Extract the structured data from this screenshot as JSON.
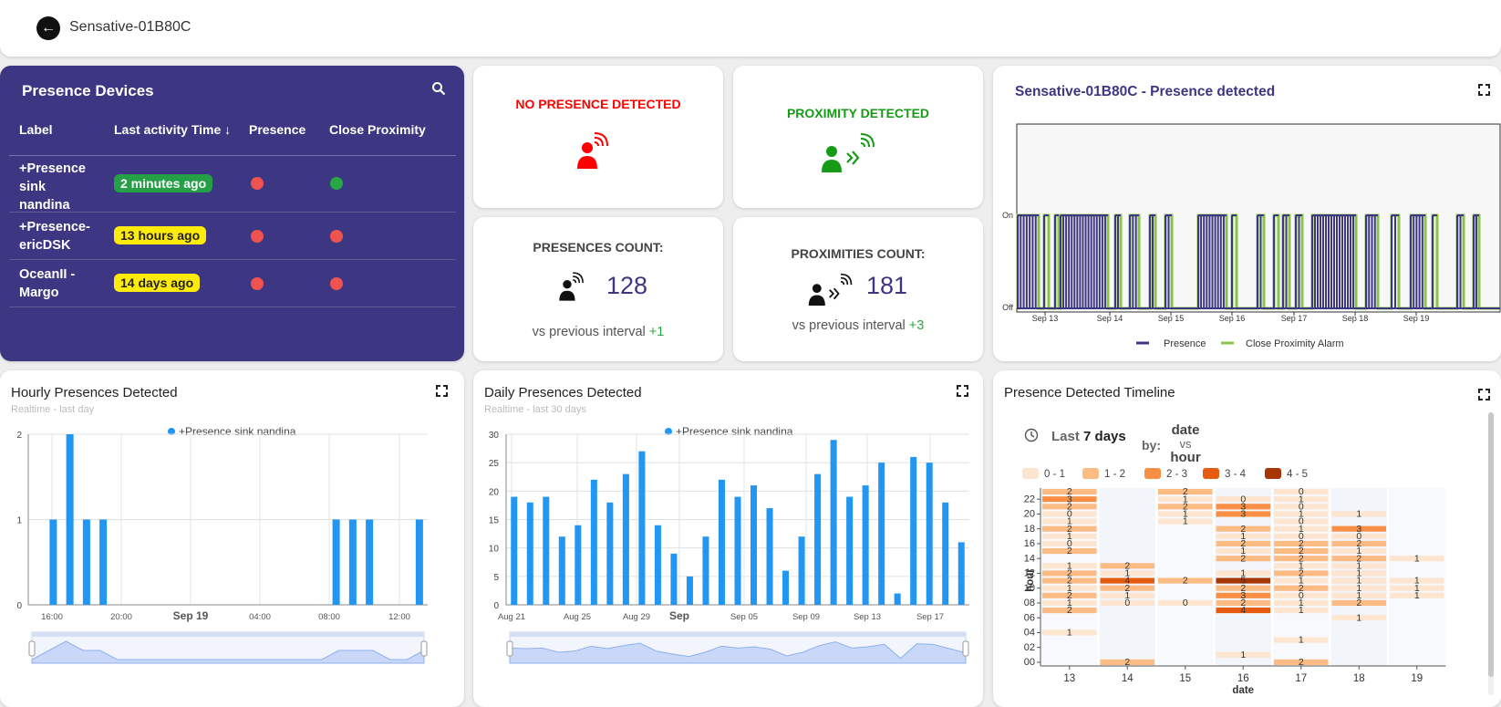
{
  "header": {
    "device_name": "Sensative-01B80C",
    "back_icon": "arrow-left-icon"
  },
  "devices": {
    "title": "Presence Devices",
    "columns": [
      "Label",
      "Last activity Time",
      "Presence",
      "Close Proximity"
    ],
    "sort_icon": "arrow-down-icon",
    "rows": [
      {
        "label": [
          "+Presence",
          "sink",
          "nandina"
        ],
        "time": "2 minutes ago",
        "time_color": "#26a047",
        "presence": "#ef5350",
        "proximity": "#27a844"
      },
      {
        "label": [
          "+Presence-",
          "ericDSK"
        ],
        "time": "13 hours ago",
        "time_color": "#ffeb0a",
        "presence": "#ef5350",
        "proximity": "#ef5350"
      },
      {
        "label": [
          "OceanII -",
          "Margo"
        ],
        "time": "14 days ago",
        "time_color": "#ffeb0a",
        "presence": "#ef5350",
        "proximity": "#ef5350"
      }
    ]
  },
  "status": {
    "presence": {
      "text": "NO PRESENCE DETECTED",
      "color": "#ff0000"
    },
    "proximity": {
      "text": "PROXIMITY DETECTED",
      "color": "#159b15"
    }
  },
  "counts": {
    "presences": {
      "title": "PRESENCES COUNT:",
      "value": "128",
      "vs": "vs previous interval",
      "delta": "+1"
    },
    "proximities": {
      "title": "PROXIMITIES COUNT:",
      "value": "181",
      "vs": "vs previous interval",
      "delta": "+3"
    }
  },
  "timeline_chart": {
    "title": "Sensative-01B80C - Presence detected",
    "y_labels": [
      "On",
      "Off"
    ],
    "x_labels": [
      "Sep 13",
      "Sep 14",
      "Sep 15",
      "Sep 16",
      "Sep 17",
      "Sep 18",
      "Sep 19"
    ],
    "legend": [
      "Presence",
      "Close Proximity Alarm"
    ],
    "colors": {
      "presence": "#3d3783",
      "proximity": "#8bc34a"
    }
  },
  "hourly": {
    "title": "Hourly Presences Detected",
    "subtitle": "Realtime - last day",
    "series_name": "+Presence sink nandina"
  },
  "daily": {
    "title": "Daily Presences Detected",
    "subtitle": "Realtime - last 30 days",
    "series_name": "+Presence sink nandina"
  },
  "heatmap": {
    "title": "Presence Detected Timeline",
    "range_prefix": "Last",
    "range_value": "7 days",
    "by": "by:",
    "date": "date",
    "vs": "vs",
    "hour": "hour",
    "legend": [
      "0 - 1",
      "1 - 2",
      "2 - 3",
      "3 - 4",
      "4 - 5"
    ],
    "legend_colors": [
      "#fde5d0",
      "#fdbb84",
      "#f88f45",
      "#e65b0f",
      "#a63603"
    ],
    "x_labels": [
      "13",
      "14",
      "15",
      "16",
      "17",
      "18",
      "19"
    ],
    "y_labels": [
      "22",
      "20",
      "18",
      "16",
      "14",
      "12",
      "10",
      "08",
      "06",
      "04",
      "02",
      "00"
    ],
    "xlabel": "date",
    "ylabel": "hour"
  },
  "chart_data": [
    {
      "type": "bar",
      "title": "Hourly Presences Detected",
      "x": [
        "15:00",
        "16:00",
        "17:00",
        "18:00",
        "19:00",
        "20:00",
        "21:00",
        "22:00",
        "23:00",
        "Sep 19",
        "01:00",
        "02:00",
        "03:00",
        "04:00",
        "05:00",
        "06:00",
        "07:00",
        "08:00",
        "09:00",
        "10:00",
        "11:00",
        "12:00",
        "13:00",
        "14:00"
      ],
      "tick_labels": [
        "16:00",
        "20:00",
        "Sep 19",
        "04:00",
        "08:00",
        "12:00"
      ],
      "series": [
        {
          "name": "+Presence sink nandina",
          "values": [
            0,
            1,
            2,
            1,
            1,
            0,
            0,
            0,
            0,
            0,
            0,
            0,
            0,
            0,
            0,
            0,
            0,
            0,
            1,
            1,
            1,
            0,
            0,
            1
          ]
        }
      ],
      "ylim": [
        0,
        2
      ],
      "yticks": [
        0,
        1,
        2
      ]
    },
    {
      "type": "bar",
      "title": "Daily Presences Detected",
      "tick_labels": [
        "Aug 21",
        "Aug 25",
        "Aug 29",
        "Sep",
        "Sep 05",
        "Sep 09",
        "Sep 13",
        "Sep 17"
      ],
      "series": [
        {
          "name": "+Presence sink nandina",
          "values": [
            19,
            18,
            19,
            12,
            14,
            22,
            18,
            23,
            27,
            14,
            9,
            5,
            12,
            22,
            19,
            21,
            17,
            6,
            12,
            23,
            29,
            19,
            21,
            25,
            2,
            26,
            25,
            18,
            11
          ]
        }
      ],
      "ylim": [
        0,
        30
      ],
      "yticks": [
        0,
        5,
        10,
        15,
        20,
        25,
        30
      ]
    },
    {
      "type": "heatmap",
      "title": "Presence Detected Timeline",
      "x": [
        "13",
        "14",
        "15",
        "16",
        "17",
        "18",
        "19"
      ],
      "cells": [
        {
          "d": 0,
          "h": 23,
          "v": 2
        },
        {
          "d": 0,
          "h": 22,
          "v": 3
        },
        {
          "d": 0,
          "h": 21,
          "v": 2
        },
        {
          "d": 0,
          "h": 20,
          "v": 0
        },
        {
          "d": 0,
          "h": 19,
          "v": 1
        },
        {
          "d": 0,
          "h": 18,
          "v": 2
        },
        {
          "d": 0,
          "h": 17,
          "v": 1
        },
        {
          "d": 0,
          "h": 16,
          "v": 0
        },
        {
          "d": 0,
          "h": 15,
          "v": 2
        },
        {
          "d": 0,
          "h": 13,
          "v": 1
        },
        {
          "d": 0,
          "h": 12,
          "v": 2
        },
        {
          "d": 0,
          "h": 11,
          "v": 2
        },
        {
          "d": 0,
          "h": 10,
          "v": 1
        },
        {
          "d": 0,
          "h": 9,
          "v": 2
        },
        {
          "d": 0,
          "h": 8,
          "v": 1
        },
        {
          "d": 0,
          "h": 7,
          "v": 2
        },
        {
          "d": 0,
          "h": 4,
          "v": 1
        },
        {
          "d": 1,
          "h": 13,
          "v": 2
        },
        {
          "d": 1,
          "h": 12,
          "v": 1
        },
        {
          "d": 1,
          "h": 11,
          "v": 4
        },
        {
          "d": 1,
          "h": 10,
          "v": 2
        },
        {
          "d": 1,
          "h": 9,
          "v": 1
        },
        {
          "d": 1,
          "h": 8,
          "v": 0
        },
        {
          "d": 1,
          "h": 0,
          "v": 2
        },
        {
          "d": 2,
          "h": 23,
          "v": 2
        },
        {
          "d": 2,
          "h": 22,
          "v": 1
        },
        {
          "d": 2,
          "h": 21,
          "v": 2
        },
        {
          "d": 2,
          "h": 20,
          "v": 1
        },
        {
          "d": 2,
          "h": 19,
          "v": 1
        },
        {
          "d": 2,
          "h": 11,
          "v": 2
        },
        {
          "d": 2,
          "h": 8,
          "v": 0
        },
        {
          "d": 3,
          "h": 22,
          "v": 0
        },
        {
          "d": 3,
          "h": 21,
          "v": 3
        },
        {
          "d": 3,
          "h": 20,
          "v": 3
        },
        {
          "d": 3,
          "h": 18,
          "v": 2
        },
        {
          "d": 3,
          "h": 17,
          "v": 1
        },
        {
          "d": 3,
          "h": 16,
          "v": 2
        },
        {
          "d": 3,
          "h": 15,
          "v": 1
        },
        {
          "d": 3,
          "h": 14,
          "v": 2
        },
        {
          "d": 3,
          "h": 12,
          "v": 1
        },
        {
          "d": 3,
          "h": 11,
          "v": 5
        },
        {
          "d": 3,
          "h": 10,
          "v": 2
        },
        {
          "d": 3,
          "h": 9,
          "v": 3
        },
        {
          "d": 3,
          "h": 8,
          "v": 2
        },
        {
          "d": 3,
          "h": 7,
          "v": 4
        },
        {
          "d": 3,
          "h": 1,
          "v": 1
        },
        {
          "d": 4,
          "h": 23,
          "v": 0
        },
        {
          "d": 4,
          "h": 22,
          "v": 1
        },
        {
          "d": 4,
          "h": 21,
          "v": 0
        },
        {
          "d": 4,
          "h": 20,
          "v": 1
        },
        {
          "d": 4,
          "h": 19,
          "v": 0
        },
        {
          "d": 4,
          "h": 18,
          "v": 1
        },
        {
          "d": 4,
          "h": 17,
          "v": 0
        },
        {
          "d": 4,
          "h": 16,
          "v": 2
        },
        {
          "d": 4,
          "h": 15,
          "v": 2
        },
        {
          "d": 4,
          "h": 14,
          "v": 2
        },
        {
          "d": 4,
          "h": 13,
          "v": 1
        },
        {
          "d": 4,
          "h": 12,
          "v": 2
        },
        {
          "d": 4,
          "h": 11,
          "v": 1
        },
        {
          "d": 4,
          "h": 10,
          "v": 2
        },
        {
          "d": 4,
          "h": 9,
          "v": 0
        },
        {
          "d": 4,
          "h": 8,
          "v": 1
        },
        {
          "d": 4,
          "h": 7,
          "v": 1
        },
        {
          "d": 4,
          "h": 3,
          "v": 1
        },
        {
          "d": 4,
          "h": 0,
          "v": 2
        },
        {
          "d": 5,
          "h": 20,
          "v": 1
        },
        {
          "d": 5,
          "h": 18,
          "v": 3
        },
        {
          "d": 5,
          "h": 17,
          "v": 0
        },
        {
          "d": 5,
          "h": 16,
          "v": 2
        },
        {
          "d": 5,
          "h": 15,
          "v": 1
        },
        {
          "d": 5,
          "h": 14,
          "v": 2
        },
        {
          "d": 5,
          "h": 13,
          "v": 1
        },
        {
          "d": 5,
          "h": 12,
          "v": 1
        },
        {
          "d": 5,
          "h": 11,
          "v": 1
        },
        {
          "d": 5,
          "h": 10,
          "v": 1
        },
        {
          "d": 5,
          "h": 9,
          "v": 1
        },
        {
          "d": 5,
          "h": 8,
          "v": 2
        },
        {
          "d": 5,
          "h": 6,
          "v": 1
        },
        {
          "d": 6,
          "h": 14,
          "v": 1
        },
        {
          "d": 6,
          "h": 11,
          "v": 1
        },
        {
          "d": 6,
          "h": 10,
          "v": 1
        },
        {
          "d": 6,
          "h": 9,
          "v": 1
        }
      ]
    }
  ]
}
